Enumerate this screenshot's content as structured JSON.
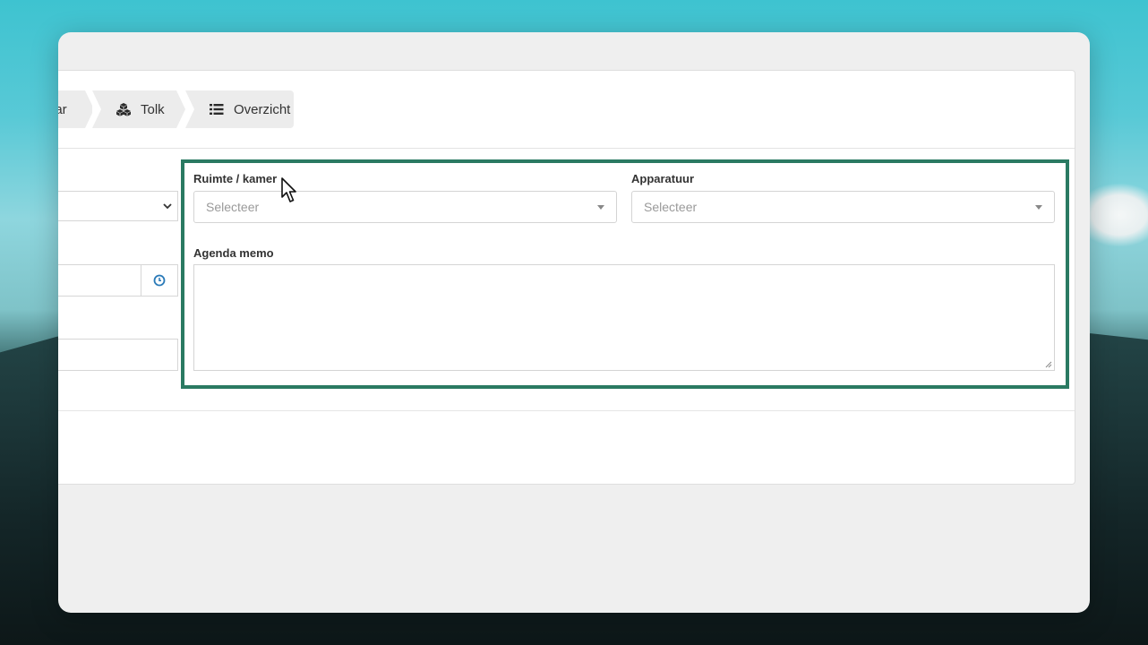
{
  "wizard": {
    "steps": [
      {
        "label": "aar",
        "icon": "none",
        "partial": true
      },
      {
        "label": "Tolk",
        "icon": "cubes-icon"
      },
      {
        "label": "Overzicht",
        "icon": "list-icon"
      }
    ]
  },
  "form": {
    "room_label": "Ruimte / kamer",
    "room_placeholder": "Selecteer",
    "equipment_label": "Apparatuur",
    "equipment_placeholder": "Selecteer",
    "memo_label": "Agenda memo",
    "memo_value": ""
  },
  "colors": {
    "highlight_border": "#2a7a62",
    "clock_icon": "#2a7ab8",
    "step_background": "#ececec"
  }
}
